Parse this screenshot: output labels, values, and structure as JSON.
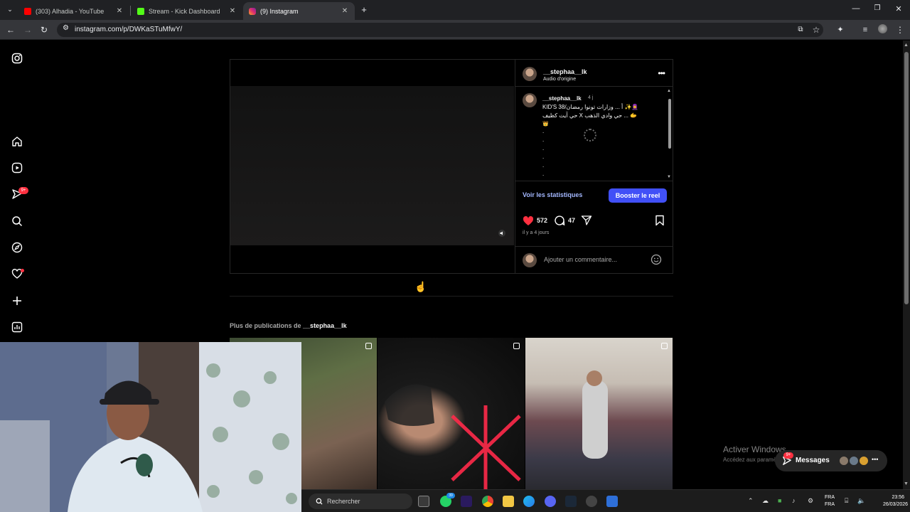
{
  "browser": {
    "tabs": [
      {
        "title": "(303) Alhadia - YouTube",
        "color": "#ff0000"
      },
      {
        "title": "Stream - Kick Dashboard",
        "color": "#53fc18"
      },
      {
        "title": "(9) Instagram",
        "color": "#e1306c"
      }
    ],
    "url": "instagram.com/p/DWKaSTuMfwY/"
  },
  "sidebar": {
    "notification_badge": "9+"
  },
  "post": {
    "username": "__stephaa__lk",
    "audio": "Audio d'origine",
    "caption": {
      "username": "__stephaa__lk",
      "age": "4 j",
      "line1": "KID'S 38/أ ... وزارات تونوا رمضان ✨🧕",
      "line2": "حي آيت كظيف X حي وادي الذهب ... 🫱",
      "line3": "👑",
      "dots": [
        ".",
        ".",
        ".",
        ".",
        ".",
        "."
      ]
    },
    "stats_link": "Voir les statistiques",
    "boost_button": "Booster le reel",
    "likes": "572",
    "comments": "47",
    "time_ago": "il y a 4 jours",
    "comment_placeholder": "Ajouter un commentaire..."
  },
  "more_posts": {
    "prefix": "Plus de publications de",
    "username": "__stephaa__lk"
  },
  "windows_watermark": {
    "line1": "Activer Windows",
    "line2": "Accédez aux paramètres pour activer Windows."
  },
  "messages": {
    "label": "Messages",
    "badge": "9+"
  },
  "taskbar": {
    "search_placeholder": "Rechercher",
    "whatsapp_badge": "39",
    "lang_top": "FRA",
    "lang_bottom": "FRA",
    "time": "23:56",
    "date": "26/03/2026"
  }
}
